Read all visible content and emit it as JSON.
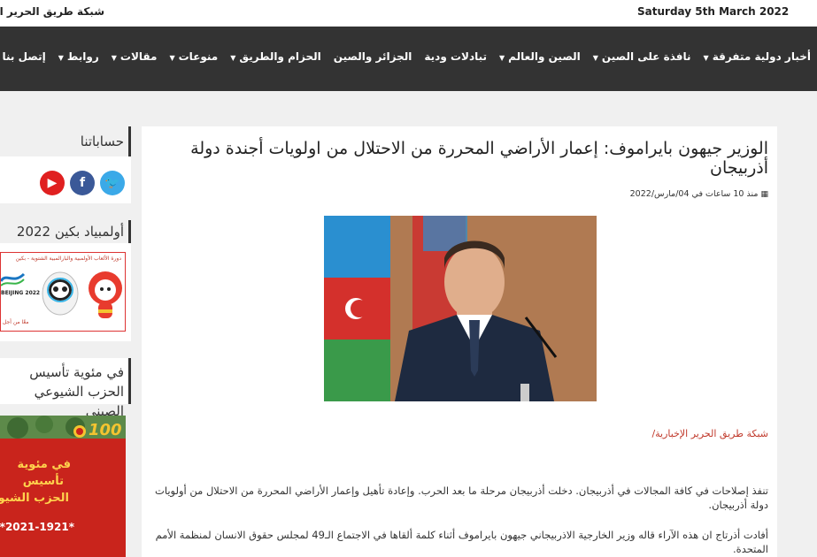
{
  "header": {
    "date": "Saturday 5th March 2022",
    "site_name": "شبكة طريق الحرير الصينية"
  },
  "nav": {
    "items": [
      {
        "label": "أخبار دولية متفرقة",
        "dropdown": true
      },
      {
        "label": "نافذة على الصين",
        "dropdown": true
      },
      {
        "label": "الصين والعالم",
        "dropdown": true
      },
      {
        "label": "تبادلات ودية",
        "dropdown": false
      },
      {
        "label": "الجزائر والصين",
        "dropdown": false
      },
      {
        "label": "الحزام والطريق",
        "dropdown": true
      },
      {
        "label": "منوعات",
        "dropdown": true
      },
      {
        "label": "مقالات",
        "dropdown": true
      },
      {
        "label": "روابط",
        "dropdown": true
      },
      {
        "label": "إتصل بنا",
        "dropdown": false
      }
    ]
  },
  "article": {
    "title": "الوزير جيهون بايراموف: إعمار الأراضي المحررة من الاحتلال من اولويات أجندة دولة أذربيجان",
    "meta": "منذ 10 ساعات في 04/مارس/2022",
    "source": "شبكة طريق الحرير الإخبارية/",
    "paragraphs": [
      "تنفذ إصلاحات في كافة المجالات في أذربيجان. دخلت أذربيجان مرحلة ما بعد الحرب. وإعادة تأهيل وإعمار الأراضي المحررة من الاحتلال من أولويات دولة أذربيجان.",
      "أفادت أذرتاج ان هذه الآراء قاله وزير الخارجية الاذربيجاني جيهون بايراموف أثناء كلمة ألقاها في الاجتماع الـ49 لمجلس حقوق الانسان لمنظمة الأمم المتحدة."
    ]
  },
  "sidebar": {
    "accounts_title": "حساباتنا",
    "social": [
      {
        "name": "twitter-icon",
        "glyph": "🐦",
        "color": "#3ba9e8"
      },
      {
        "name": "facebook-icon",
        "glyph": "f",
        "color": "#3b5998"
      },
      {
        "name": "youtube-icon",
        "glyph": "▶",
        "color": "#e02020"
      }
    ],
    "olympics_title": "أولمبياد بكين 2022",
    "olympics_banner": {
      "heading": "دورة الألعاب الأولمبية والبارالمبية الشتوية - بكين",
      "logo_text": "BEIJING 2022",
      "footer": "معًا من أجل"
    },
    "cpc_title": "في مئوية تأسيس الحزب الشيوعي الصيني",
    "cpc_banner": {
      "line1": "في مئوية",
      "line2": "تأسيس",
      "line3": "الحزب الشيوعي الصيني",
      "years": "*2021-1921*",
      "badge": "100"
    }
  },
  "colors": {
    "nav_bg": "#333333",
    "accent_red": "#c0392b"
  }
}
